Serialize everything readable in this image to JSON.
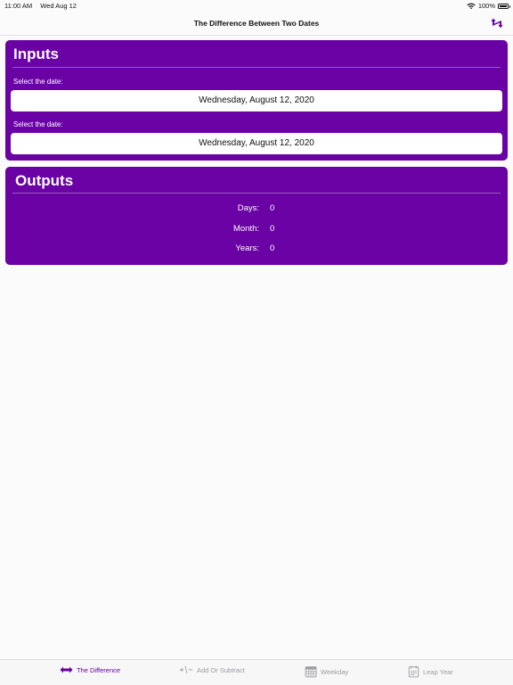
{
  "status_bar": {
    "time": "11:00 AM",
    "date": "Wed Aug 12",
    "battery": "100%"
  },
  "nav": {
    "title": "The Difference Between Two Dates",
    "action_icon": "swap-arrows-icon"
  },
  "inputs": {
    "title": "Inputs",
    "fields": [
      {
        "label": "Select the date:",
        "value": "Wednesday, August 12, 2020"
      },
      {
        "label": "Select the date:",
        "value": "Wednesday, August 12, 2020"
      }
    ]
  },
  "outputs": {
    "title": "Outputs",
    "rows": [
      {
        "label": "Days:",
        "value": "0"
      },
      {
        "label": "Month:",
        "value": "0"
      },
      {
        "label": "Years:",
        "value": "0"
      }
    ]
  },
  "tabs": [
    {
      "label": "The Difference",
      "icon": "double-arrow-icon",
      "active": true
    },
    {
      "label": "Add Or Subtract",
      "icon": "plus-minus-icon",
      "active": false
    },
    {
      "label": "Weekday",
      "icon": "calendar-icon",
      "active": false
    },
    {
      "label": "Leap Year",
      "icon": "calendar-page-icon",
      "active": false
    }
  ],
  "colors": {
    "accent": "#6a01a4",
    "background": "#fbfbfc",
    "inactive_tab": "#9b9ba0"
  }
}
